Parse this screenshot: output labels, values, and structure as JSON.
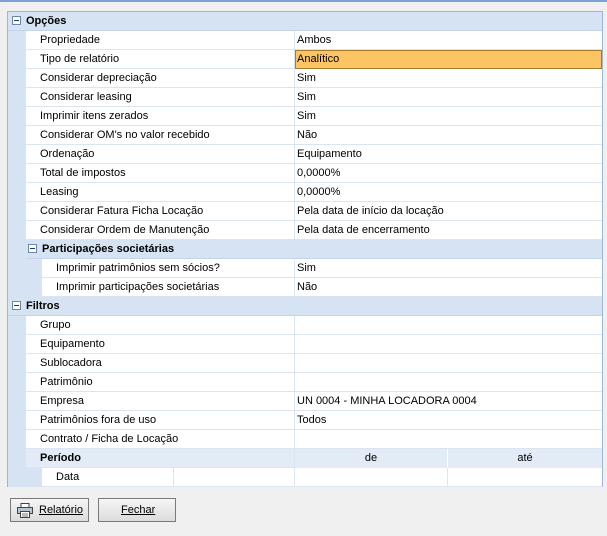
{
  "groups": {
    "opcoes": {
      "label": "Opções",
      "rows": [
        {
          "name": "Propriedade",
          "value": "Ambos"
        },
        {
          "name": "Tipo de relatório",
          "value": "Analítico"
        },
        {
          "name": "Considerar depreciação",
          "value": "Sim"
        },
        {
          "name": "Considerar leasing",
          "value": "Sim"
        },
        {
          "name": "Imprimir itens zerados",
          "value": "Sim"
        },
        {
          "name": "Considerar OM's no valor recebido",
          "value": "Não"
        },
        {
          "name": "Ordenação",
          "value": "Equipamento"
        },
        {
          "name": "Total de impostos",
          "value": "0,0000%"
        },
        {
          "name": "Leasing",
          "value": "0,0000%"
        },
        {
          "name": "Considerar Fatura Ficha Locação",
          "value": "Pela data de início da locação"
        },
        {
          "name": "Considerar Ordem de Manutenção",
          "value": "Pela data de encerramento"
        }
      ],
      "sub": {
        "label": "Participações societárias",
        "rows": [
          {
            "name": "Imprimir patrimônios sem sócios?",
            "value": "Sim"
          },
          {
            "name": "Imprimir participações societárias",
            "value": "Não"
          }
        ]
      }
    },
    "filtros": {
      "label": "Filtros",
      "rows": [
        {
          "name": "Grupo",
          "value": ""
        },
        {
          "name": "Equipamento",
          "value": ""
        },
        {
          "name": "Sublocadora",
          "value": ""
        },
        {
          "name": "Patrimônio",
          "value": ""
        },
        {
          "name": "Empresa",
          "value": "UN 0004 - MINHA LOCADORA 0004"
        },
        {
          "name": "Patrimônios fora de uso",
          "value": "Todos"
        },
        {
          "name": "Contrato / Ficha de Locação",
          "value": ""
        }
      ],
      "periodo": {
        "label": "Período",
        "from_header": "de",
        "to_header": "até",
        "row_label": "Data",
        "from_value": "",
        "to_value": ""
      }
    }
  },
  "buttons": {
    "report": "Relatório",
    "close": "Fechar"
  },
  "colors": {
    "category_bg": "#d6e3f3",
    "selected_bg": "#fcc463",
    "border": "#9db6d6"
  }
}
